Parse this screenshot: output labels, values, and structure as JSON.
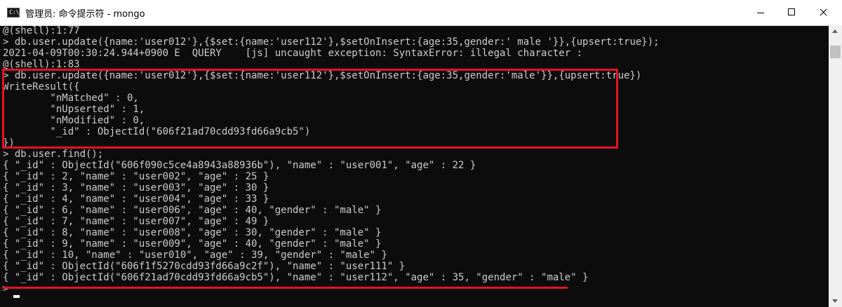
{
  "window": {
    "icon_text": "C:\\",
    "title": "管理员: 命令提示符 - mongo",
    "minimize_icon": "minimize-icon",
    "maximize_icon": "maximize-icon",
    "close_icon": "close-icon"
  },
  "console": {
    "lines": [
      "@(shell):1:77",
      "> db.user.update({name:'user012'},{$set:{name:'user112'},$setOnInsert:{age:35,gender:' male '}},{upsert:true});",
      "2021-04-09T00:30:24.944+0900 E  QUERY    [js] uncaught exception: SyntaxError: illegal character :",
      "@(shell):1:83",
      "> db.user.update({name:'user012'},{$set:{name:'user112'},$setOnInsert:{age:35,gender:'male'}},{upsert:true})",
      "WriteResult({",
      "        \"nMatched\" : 0,",
      "        \"nUpserted\" : 1,",
      "        \"nModified\" : 0,",
      "        \"_id\" : ObjectId(\"606f21ad70cdd93fd66a9cb5\")",
      "})",
      "> db.user.find();",
      "{ \"_id\" : ObjectId(\"606f090c5ce4a8943a88936b\"), \"name\" : \"user001\", \"age\" : 22 }",
      "{ \"_id\" : 2, \"name\" : \"user002\", \"age\" : 25 }",
      "{ \"_id\" : 3, \"name\" : \"user003\", \"age\" : 30 }",
      "{ \"_id\" : 4, \"name\" : \"user004\", \"age\" : 33 }",
      "{ \"_id\" : 6, \"name\" : \"user006\", \"age\" : 40, \"gender\" : \"male\" }",
      "{ \"_id\" : 7, \"name\" : \"user007\", \"age\" : 49 }",
      "{ \"_id\" : 8, \"name\" : \"user008\", \"age\" : 30, \"gender\" : \"male\" }",
      "{ \"_id\" : 9, \"name\" : \"user009\", \"age\" : 40, \"gender\" : \"male\" }",
      "{ \"_id\" : 10, \"name\" : \"user010\", \"age\" : 39, \"gender\" : \"male\" }",
      "{ \"_id\" : ObjectId(\"606f1f5270cdd93fd66a9c2f\"), \"name\" : \"user111\" }",
      "{ \"_id\" : ObjectId(\"606f21ad70cdd93fd66a9cb5\"), \"name\" : \"user112\", \"age\" : 35, \"gender\" : \"male\" }",
      ">"
    ],
    "text_color": "#cccccc",
    "background_color": "#0c0c0c",
    "annotation_color": "#e81123"
  }
}
